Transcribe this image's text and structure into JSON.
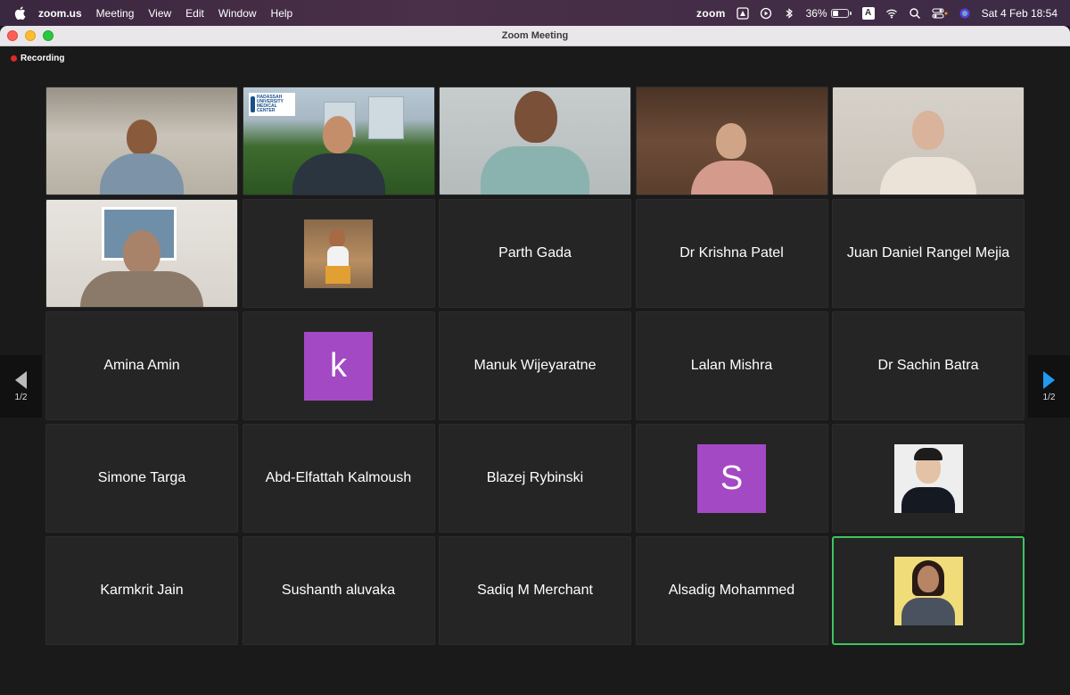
{
  "menubar": {
    "app": "zoom.us",
    "items": [
      "Meeting",
      "View",
      "Edit",
      "Window",
      "Help"
    ],
    "zoom_label": "zoom",
    "battery_text": "36%",
    "battery_level": 0.36,
    "input_source": "A",
    "clock": "Sat 4 Feb  18:54"
  },
  "window": {
    "title": "Zoom Meeting",
    "recording_label": "Recording"
  },
  "pager": {
    "left_label": "1/2",
    "right_label": "1/2"
  },
  "participants": {
    "parth": "Parth Gada",
    "krishna": "Dr Krishna Patel",
    "juan": "Juan Daniel Rangel Mejia",
    "amina": "Amina Amin",
    "k_avatar": "k",
    "manuk": "Manuk Wijeyaratne",
    "lalan": "Lalan Mishra",
    "sachin": "Dr Sachin Batra",
    "simone": "Simone Targa",
    "abd": "Abd-Elfattah Kalmoush",
    "blazej": "Blazej Rybinski",
    "s_avatar": "S",
    "karmkrit": "Karmkrit Jain",
    "sushanth": "Sushanth aluvaka",
    "sadiq": "Sadiq M Merchant",
    "alsadig": "Alsadig Mohammed"
  },
  "hospital_logo": "HADASSAH UNIVERSITY MEDICAL CENTER",
  "colors": {
    "avatar_purple": "#a349c3",
    "active_speaker": "#3ec45f",
    "next_arrow": "#1f9cf0",
    "recording_dot": "#e02828"
  }
}
